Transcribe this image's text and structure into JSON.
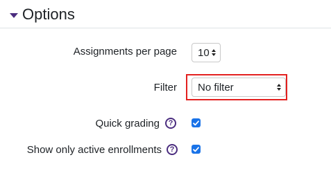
{
  "section": {
    "title": "Options",
    "collapse_icon": "caret-down-icon",
    "accent_color": "#4b2d7f"
  },
  "fields": {
    "assignments_per_page": {
      "label": "Assignments per page",
      "value": "10",
      "control": "stepper"
    },
    "filter": {
      "label": "Filter",
      "selected": "No filter",
      "control": "select"
    },
    "quick_grading": {
      "label": "Quick grading",
      "help_icon": "help-icon",
      "help_glyph": "?",
      "checked": true
    },
    "show_only_active": {
      "label": "Show only active enrollments",
      "help_icon": "help-icon",
      "help_glyph": "?",
      "checked": true
    }
  },
  "colors": {
    "highlight": "#e3201f",
    "checkbox": "#1a73e8"
  }
}
